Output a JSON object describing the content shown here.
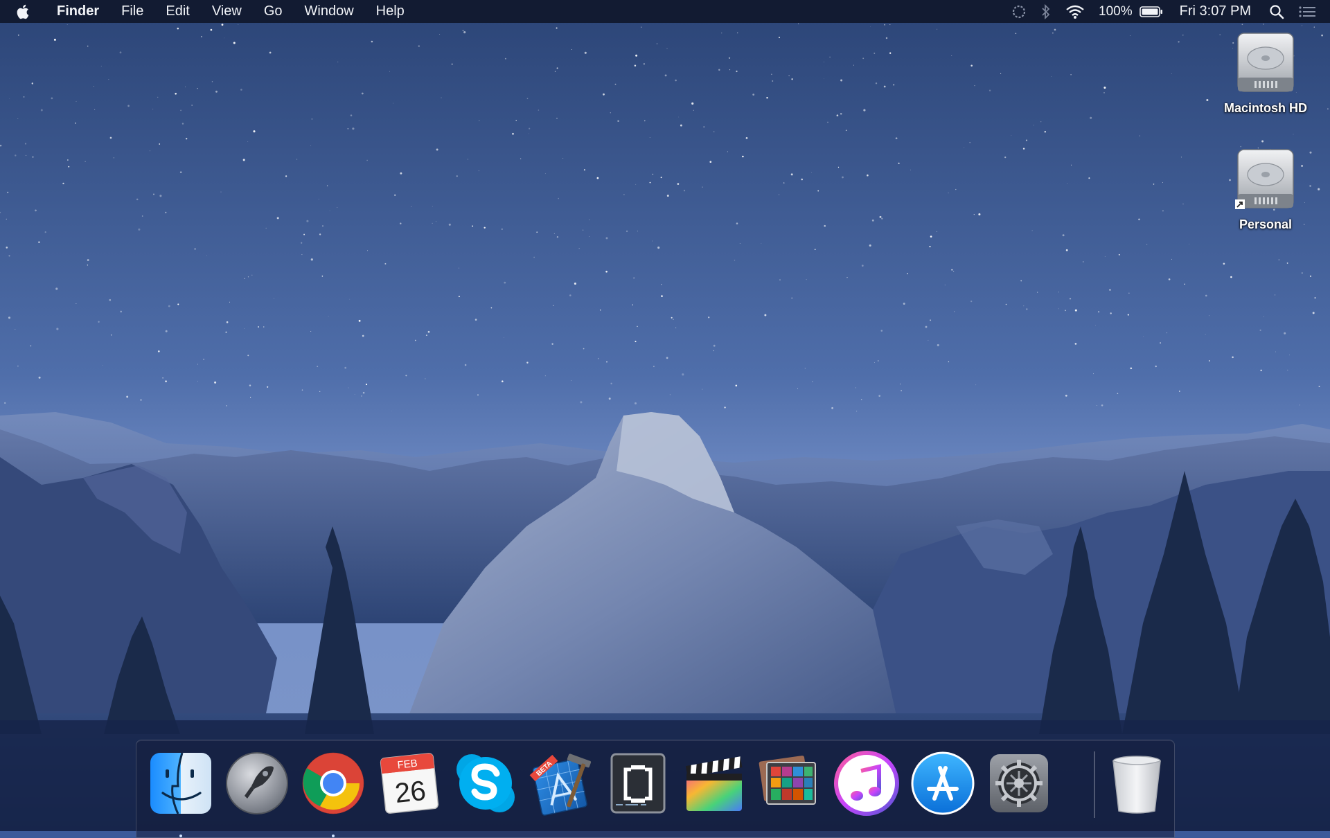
{
  "menubar": {
    "app_name": "Finder",
    "menus": [
      "File",
      "Edit",
      "View",
      "Go",
      "Window",
      "Help"
    ],
    "battery_percent": "100%",
    "clock": "Fri 3:07 PM",
    "status_icons": [
      "sync-icon",
      "bluetooth-icon",
      "wifi-icon",
      "battery-icon",
      "spotlight-icon",
      "notification-center-icon"
    ]
  },
  "desktop": {
    "icons": [
      {
        "label": "Macintosh HD",
        "icon": "hard-drive-icon"
      },
      {
        "label": "Personal",
        "icon": "hard-drive-alias-icon"
      }
    ]
  },
  "dock": {
    "apps": [
      {
        "name": "Finder",
        "icon": "finder-icon",
        "running": true
      },
      {
        "name": "Launchpad",
        "icon": "launchpad-icon",
        "running": false
      },
      {
        "name": "Google Chrome",
        "icon": "chrome-icon",
        "running": true
      },
      {
        "name": "Calendar",
        "icon": "calendar-icon",
        "month": "FEB",
        "day": "26",
        "running": false
      },
      {
        "name": "Skype",
        "icon": "skype-icon",
        "running": false
      },
      {
        "name": "Xcode Beta",
        "icon": "xcode-beta-icon",
        "badge": "BETA",
        "running": false
      },
      {
        "name": "Brackets",
        "icon": "brackets-icon",
        "running": false
      },
      {
        "name": "Final Cut Pro",
        "icon": "final-cut-pro-icon",
        "running": false
      },
      {
        "name": "Photo Gallery",
        "icon": "photo-gallery-icon",
        "running": false
      },
      {
        "name": "iTunes",
        "icon": "itunes-icon",
        "running": false
      },
      {
        "name": "App Store",
        "icon": "app-store-icon",
        "running": false
      },
      {
        "name": "System Preferences",
        "icon": "system-preferences-icon",
        "running": false
      }
    ],
    "trash": {
      "name": "Trash",
      "icon": "trash-icon"
    }
  },
  "colors": {
    "sky_top": "#2c4577",
    "sky_bottom": "#6f8fc9",
    "menubar_bg": "#10182c",
    "dock_bg": "#141e3c"
  }
}
